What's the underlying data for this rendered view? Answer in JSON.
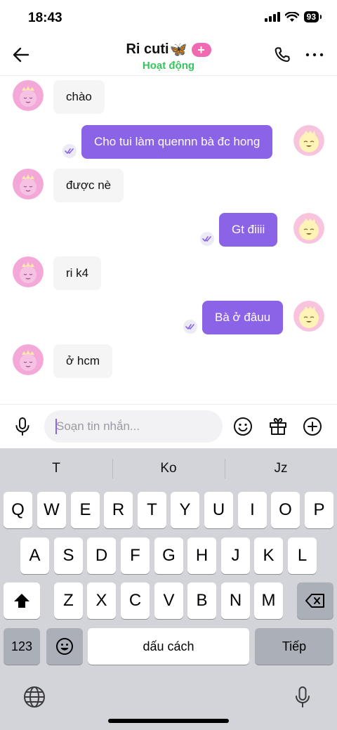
{
  "status_bar": {
    "time": "18:43",
    "battery": "93"
  },
  "header": {
    "title": "Ri cuti",
    "title_emoji": "🦋",
    "status": "Hoạt động"
  },
  "messages": [
    {
      "side": "in",
      "text": "chào"
    },
    {
      "side": "out",
      "text": "Cho tui làm quennn bà đc hong",
      "seen": true
    },
    {
      "side": "in",
      "text": "được nè"
    },
    {
      "side": "out",
      "text": "Gt điiii",
      "seen": true
    },
    {
      "side": "in",
      "text": "ri k4"
    },
    {
      "side": "out",
      "text": "Bà ở đâuu",
      "seen": true
    },
    {
      "side": "in",
      "text": "ở hcm"
    }
  ],
  "composer": {
    "placeholder": "Soạn tin nhắn..."
  },
  "keyboard": {
    "suggestions": [
      "T",
      "Ko",
      "Jz"
    ],
    "row1": [
      "Q",
      "W",
      "E",
      "R",
      "T",
      "Y",
      "U",
      "I",
      "O",
      "P"
    ],
    "row2": [
      "A",
      "S",
      "D",
      "F",
      "G",
      "H",
      "J",
      "K",
      "L"
    ],
    "row3": [
      "Z",
      "X",
      "C",
      "V",
      "B",
      "N",
      "M"
    ],
    "numbers_key": "123",
    "space_key": "dấu cách",
    "return_key": "Tiếp"
  },
  "colors": {
    "accent": "#8b63e6",
    "online": "#37c45e",
    "badge": "#f06ab1"
  }
}
